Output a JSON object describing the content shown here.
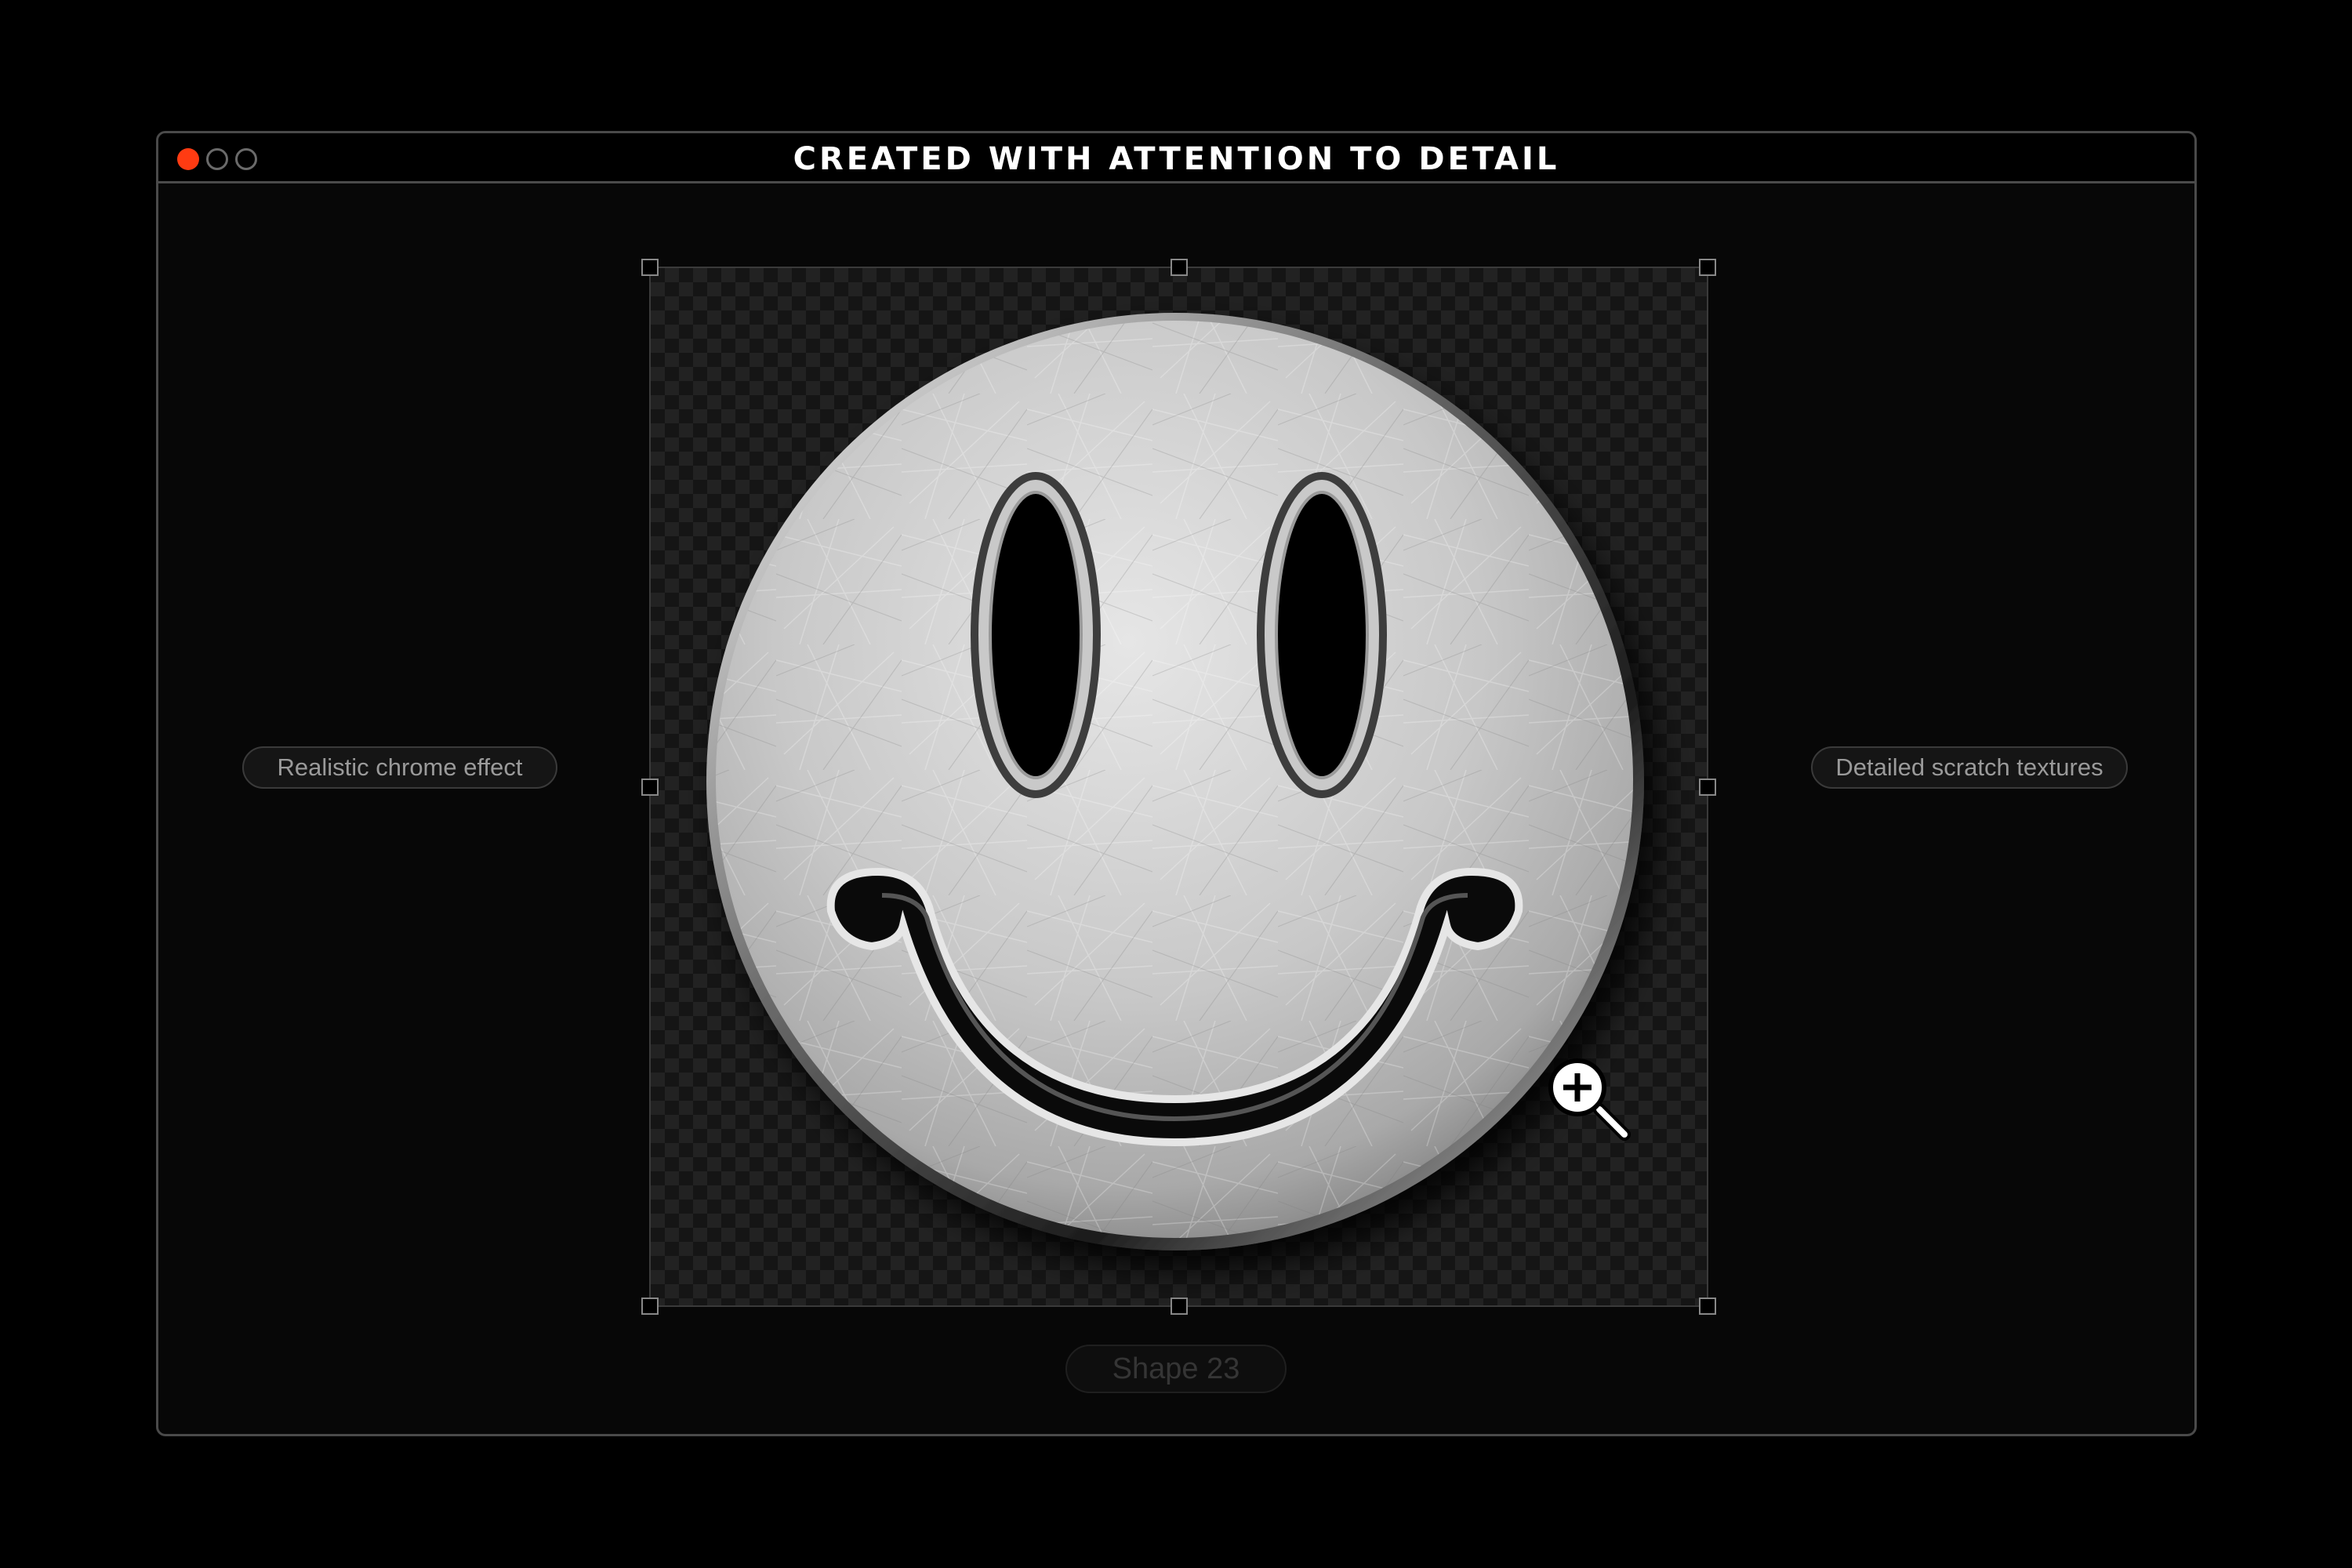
{
  "window": {
    "title": "CREATED WITH ATTENTION TO DETAIL",
    "controls": {
      "close_color": "#ff3b12"
    }
  },
  "labels": {
    "left_pill": "Realistic chrome effect",
    "right_pill": "Detailed scratch textures",
    "layer_name": "Shape 23"
  },
  "canvas": {
    "subject_icon": "smiley-face-icon",
    "cursor_icon": "zoom-in-icon"
  }
}
